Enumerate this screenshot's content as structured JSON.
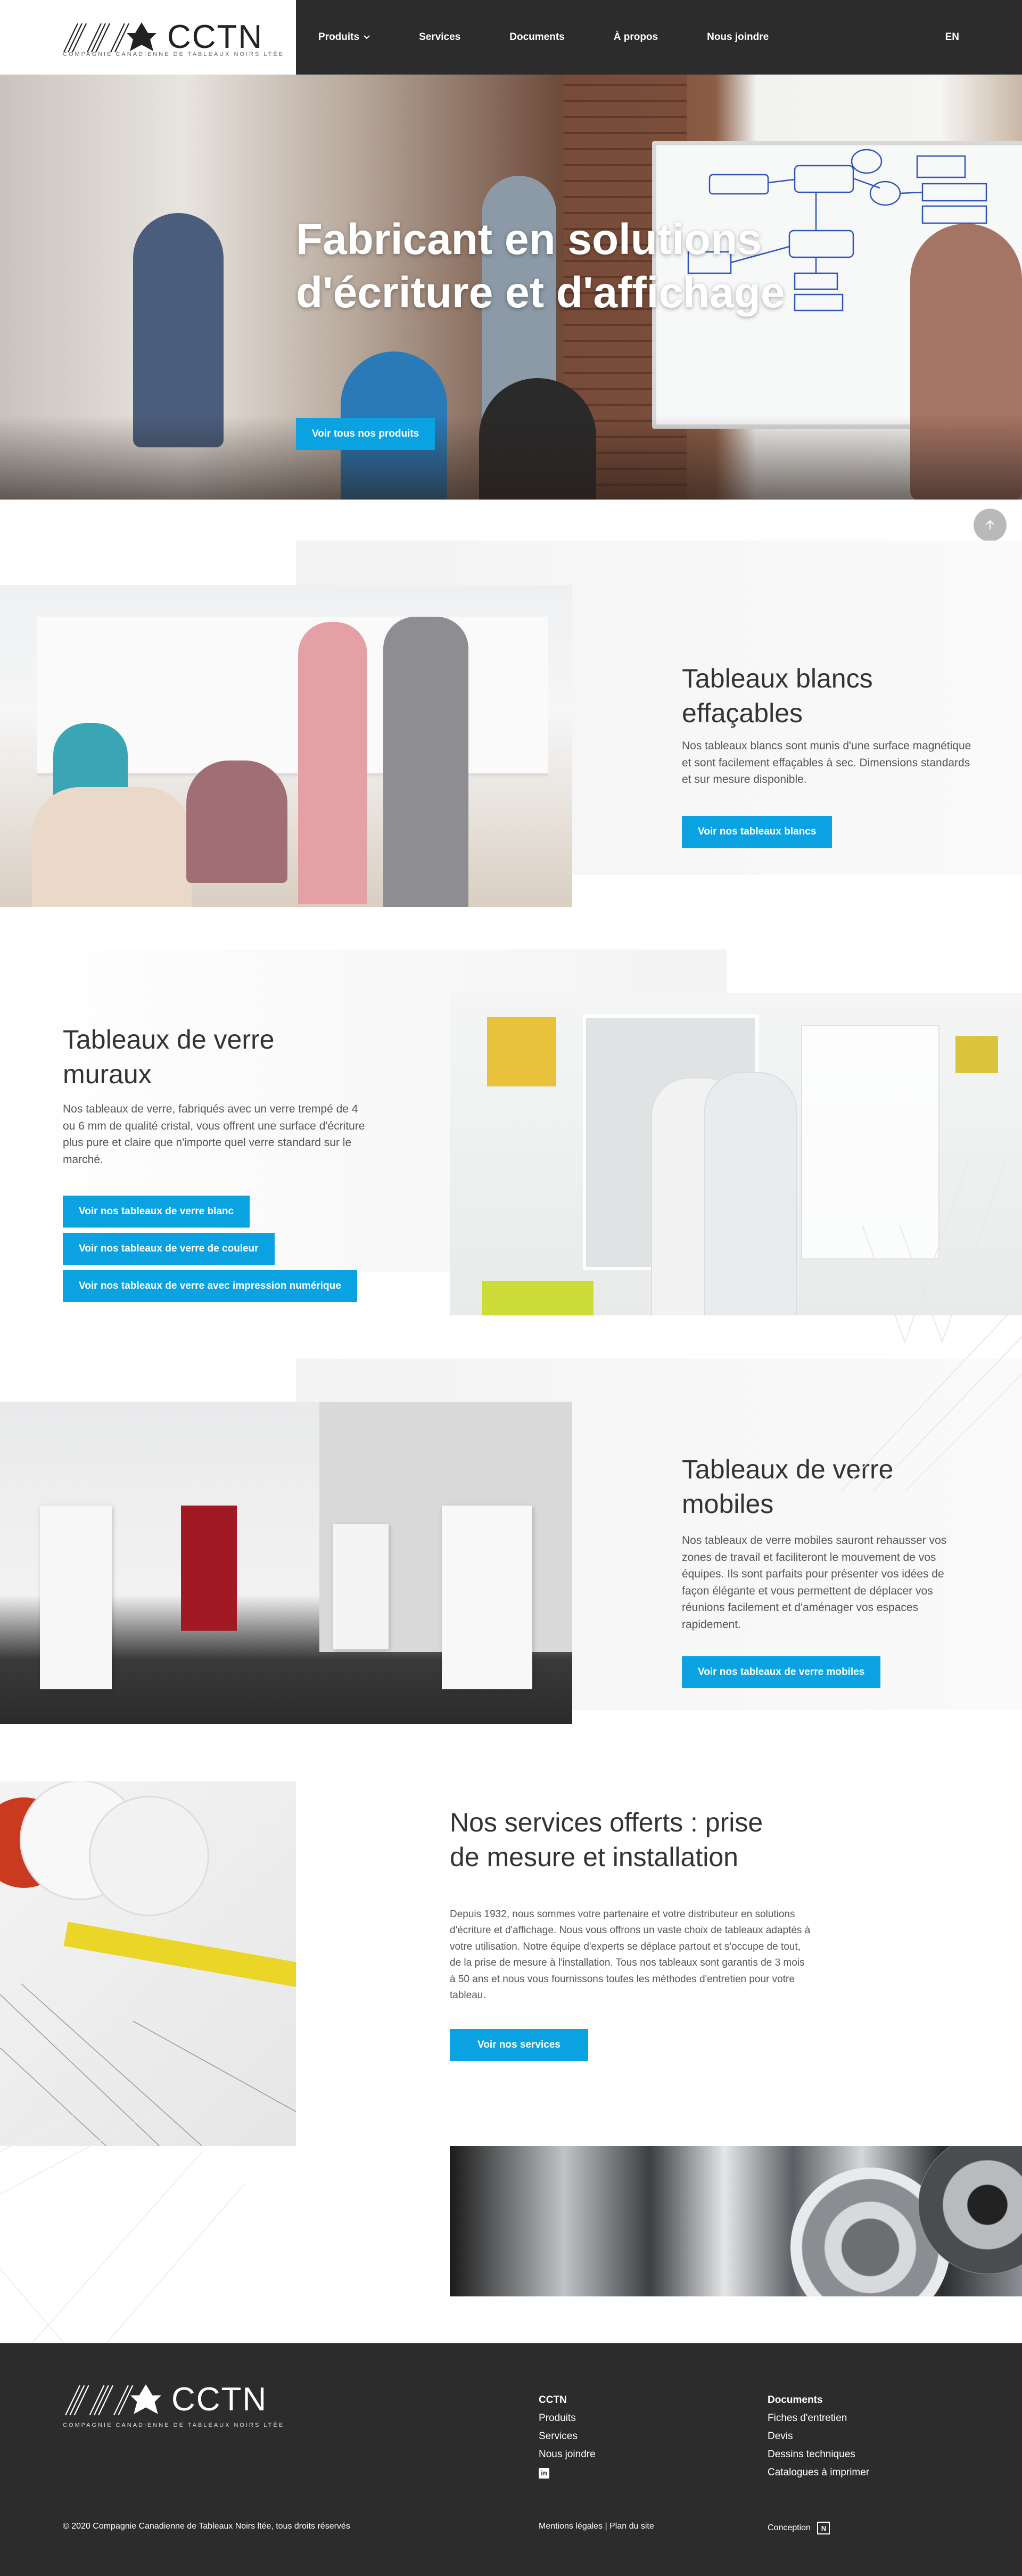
{
  "header": {
    "logo_text": "CCTN",
    "logo_subtitle": "COMPAGNIE CANADIENNE DE TABLEAUX NOIRS LTÉE",
    "nav": [
      {
        "label": "Produits",
        "has_dropdown": true
      },
      {
        "label": "Services"
      },
      {
        "label": "Documents"
      },
      {
        "label": "À propos"
      },
      {
        "label": "Nous joindre"
      }
    ],
    "lang": "EN"
  },
  "hero": {
    "title_line1": "Fabricant en solutions",
    "title_line2": "d'écriture et d'affichage",
    "button": "Voir tous nos produits"
  },
  "sections": {
    "whiteboards": {
      "title_line1": "Tableaux blancs",
      "title_line2": "effaçables",
      "text": "Nos tableaux blancs sont munis d'une surface magnétique et sont facilement effaçables à sec. Dimensions standards et sur mesure disponible.",
      "button": "Voir nos tableaux blancs"
    },
    "glass_wall": {
      "title_line1": "Tableaux de verre",
      "title_line2": "muraux",
      "text": "Nos tableaux de verre, fabriqués avec un verre trempé de 4 ou 6 mm de qualité cristal, vous offrent une surface d'écriture plus pure et claire que n'importe quel verre standard sur le marché.",
      "buttons": [
        "Voir nos tableaux de verre blanc",
        "Voir nos tableaux de verre de couleur",
        "Voir nos tableaux de verre avec impression numérique"
      ]
    },
    "glass_mobile": {
      "title_line1": "Tableaux de verre",
      "title_line2": "mobiles",
      "text": "Nos tableaux de verre mobiles sauront rehausser vos zones de travail et faciliteront le mouvement de vos équipes. Ils sont parfaits pour présenter vos idées de façon élégante et vous permettent de déplacer vos réunions facilement et d'aménager vos espaces rapidement.",
      "button": "Voir nos tableaux de verre mobiles"
    },
    "services": {
      "title_line1": "Nos services offerts : prise",
      "title_line2": "de mesure et installation",
      "text": "Depuis 1932, nous sommes votre partenaire et votre distributeur en solutions d'écriture et d'affichage. Nous vous offrons un vaste choix de tableaux adaptés à votre utilisation. Notre équipe d'experts se déplace partout et s'occupe de tout, de la prise de mesure à l'installation. Tous nos tableaux sont garantis de 3 mois à 50 ans et nous vous fournissons toutes les méthodes d'entretien pour votre tableau.",
      "button": "Voir nos services"
    }
  },
  "footer": {
    "logo_text": "CCTN",
    "logo_subtitle": "COMPAGNIE CANADIENNE DE TABLEAUX NOIRS LTÉE",
    "col1": {
      "heading": "CCTN",
      "links": [
        "Produits",
        "Services",
        "Nous joindre"
      ]
    },
    "col2": {
      "heading": "Documents",
      "links": [
        "Fiches d'entretien",
        "Devis",
        "Dessins techniques",
        "Catalogues à imprimer"
      ]
    },
    "copyright": "© 2020 Compagnie Canadienne de Tableaux Noirs ltée, tous droits réservés",
    "legal": "Mentions légales | Plan du site",
    "conception": "Conception",
    "conception_badge": "N"
  },
  "colors": {
    "accent": "#0aa2e0",
    "dark": "#2c2c2c",
    "panel": "#f5f5f5"
  }
}
